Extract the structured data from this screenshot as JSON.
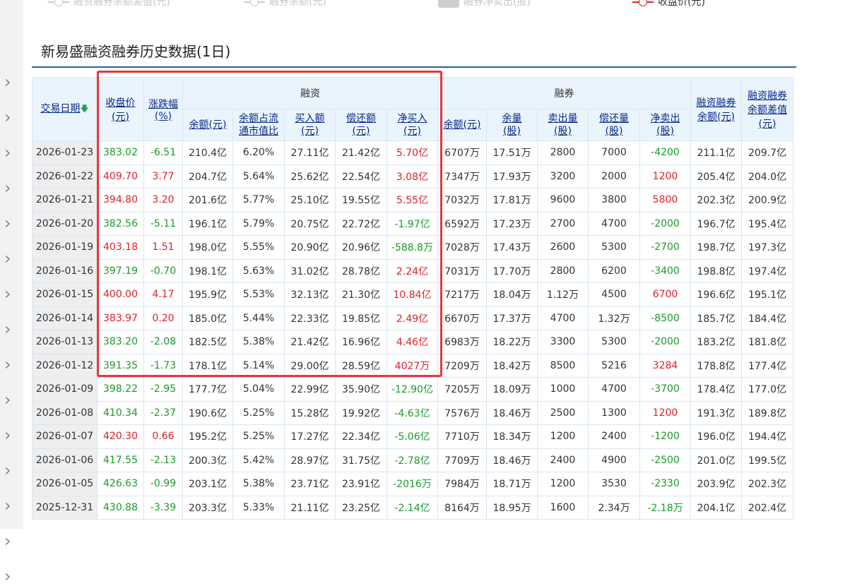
{
  "legend": {
    "items": [
      {
        "label": "融资融券余额差值(元)",
        "type": "line"
      },
      {
        "label": "融券余额(元)",
        "type": "line"
      },
      {
        "label": "融券净卖出(股)",
        "type": "box"
      },
      {
        "label": "收盘价(元)",
        "type": "line-red"
      }
    ]
  },
  "page_title": "新易盛融资融券历史数据(1日)",
  "table": {
    "header": {
      "date": "交易日期",
      "date_sort_icon": "arrow-down-icon",
      "close": "收盘价(元)",
      "change": "涨跌幅(%)",
      "margin_group": "融资",
      "short_group": "融券",
      "total": "融资融券余额(元)",
      "diff": "融资融券余额差值(元)",
      "margin_cols": [
        "余额(元)",
        "余额占流通市值比",
        "买入额(元)",
        "偿还额(元)",
        "净买入(元)"
      ],
      "short_cols": [
        "余额(元)",
        "余量(股)",
        "卖出量(股)",
        "偿还量(股)",
        "净卖出(股)"
      ]
    },
    "rows": [
      [
        "2026-01-23",
        "383.02",
        "-6.51",
        "210.4亿",
        "6.20%",
        "27.11亿",
        "21.42亿",
        "5.70亿",
        "6707万",
        "17.51万",
        "2800",
        "7000",
        "-4200",
        "211.1亿",
        "209.7亿"
      ],
      [
        "2026-01-22",
        "409.70",
        "3.77",
        "204.7亿",
        "5.64%",
        "25.62亿",
        "22.54亿",
        "3.08亿",
        "7347万",
        "17.93万",
        "3200",
        "2000",
        "1200",
        "205.4亿",
        "204.0亿"
      ],
      [
        "2026-01-21",
        "394.80",
        "3.20",
        "201.6亿",
        "5.77%",
        "25.10亿",
        "19.55亿",
        "5.55亿",
        "7032万",
        "17.81万",
        "9600",
        "3800",
        "5800",
        "202.3亿",
        "200.9亿"
      ],
      [
        "2026-01-20",
        "382.56",
        "-5.11",
        "196.1亿",
        "5.79%",
        "20.75亿",
        "22.72亿",
        "-1.97亿",
        "6592万",
        "17.23万",
        "2700",
        "4700",
        "-2000",
        "196.7亿",
        "195.4亿"
      ],
      [
        "2026-01-19",
        "403.18",
        "1.51",
        "198.0亿",
        "5.55%",
        "20.90亿",
        "20.96亿",
        "-588.8万",
        "7028万",
        "17.43万",
        "2600",
        "5300",
        "-2700",
        "198.7亿",
        "197.3亿"
      ],
      [
        "2026-01-16",
        "397.19",
        "-0.70",
        "198.1亿",
        "5.63%",
        "31.02亿",
        "28.78亿",
        "2.24亿",
        "7031万",
        "17.70万",
        "2800",
        "6200",
        "-3400",
        "198.8亿",
        "197.4亿"
      ],
      [
        "2026-01-15",
        "400.00",
        "4.17",
        "195.9亿",
        "5.53%",
        "32.13亿",
        "21.30亿",
        "10.84亿",
        "7217万",
        "18.04万",
        "1.12万",
        "4500",
        "6700",
        "196.6亿",
        "195.1亿"
      ],
      [
        "2026-01-14",
        "383.97",
        "0.20",
        "185.0亿",
        "5.44%",
        "22.33亿",
        "19.85亿",
        "2.49亿",
        "6670万",
        "17.37万",
        "4700",
        "1.32万",
        "-8500",
        "185.7亿",
        "184.4亿"
      ],
      [
        "2026-01-13",
        "383.20",
        "-2.08",
        "182.5亿",
        "5.38%",
        "21.42亿",
        "16.96亿",
        "4.46亿",
        "6983万",
        "18.22万",
        "3300",
        "5300",
        "-2000",
        "183.2亿",
        "181.8亿"
      ],
      [
        "2026-01-12",
        "391.35",
        "-1.73",
        "178.1亿",
        "5.14%",
        "29.00亿",
        "28.59亿",
        "4027万",
        "7209万",
        "18.42万",
        "8500",
        "5216",
        "3284",
        "178.8亿",
        "177.4亿"
      ],
      [
        "2026-01-09",
        "398.22",
        "-2.95",
        "177.7亿",
        "5.04%",
        "22.99亿",
        "35.90亿",
        "-12.90亿",
        "7205万",
        "18.09万",
        "1000",
        "4700",
        "-3700",
        "178.4亿",
        "177.0亿"
      ],
      [
        "2026-01-08",
        "410.34",
        "-2.37",
        "190.6亿",
        "5.25%",
        "15.28亿",
        "19.92亿",
        "-4.63亿",
        "7576万",
        "18.46万",
        "2500",
        "1300",
        "1200",
        "191.3亿",
        "189.8亿"
      ],
      [
        "2026-01-07",
        "420.30",
        "0.66",
        "195.2亿",
        "5.25%",
        "17.27亿",
        "22.34亿",
        "-5.06亿",
        "7710万",
        "18.34万",
        "1200",
        "2400",
        "-1200",
        "196.0亿",
        "194.4亿"
      ],
      [
        "2026-01-06",
        "417.55",
        "-2.13",
        "200.3亿",
        "5.42%",
        "28.97亿",
        "31.75亿",
        "-2.78亿",
        "7709万",
        "18.46万",
        "2400",
        "4900",
        "-2500",
        "201.0亿",
        "199.5亿"
      ],
      [
        "2026-01-05",
        "426.63",
        "-0.99",
        "203.1亿",
        "5.38%",
        "23.71亿",
        "23.91亿",
        "-2016万",
        "7984万",
        "18.71万",
        "1200",
        "3530",
        "-2330",
        "203.9亿",
        "202.3亿"
      ],
      [
        "2025-12-31",
        "430.88",
        "-3.39",
        "203.3亿",
        "5.33%",
        "21.11亿",
        "23.25亿",
        "-2.14亿",
        "8164万",
        "18.95万",
        "1600",
        "2.34万",
        "-2.18万",
        "204.1亿",
        "202.4亿"
      ]
    ]
  },
  "colors": {
    "up": "#e0202a",
    "down": "#1a9a2a",
    "header_bg": "#eaf4fc",
    "highlight_box": "#e8363c",
    "title_rule": "#2a5caa"
  }
}
